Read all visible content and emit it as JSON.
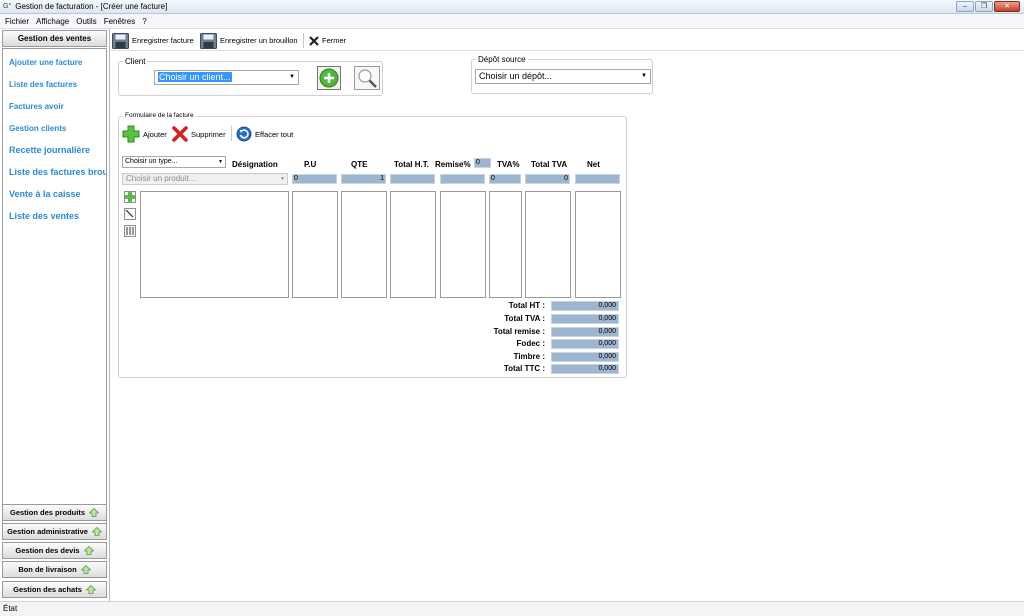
{
  "window": {
    "app_glyph": "G°",
    "title": "Gestion de facturation - [Créer une facture]"
  },
  "menu": [
    "Fichier",
    "Affichage",
    "Outils",
    "Fenêtres",
    "?"
  ],
  "sidebar": {
    "header": "Gestion des ventes",
    "links": [
      "Ajouter une facture",
      "Liste des factures",
      "Factures avoir",
      "Gestion clients",
      "Recette journalière",
      "Liste des factures brou",
      "Vente à la caisse",
      "Liste des ventes"
    ],
    "sections": [
      "Gestion des produits",
      "Gestion administrative",
      "Gestion des devis",
      "Bon de livraison",
      "Gestion des achats"
    ]
  },
  "toolbar": {
    "save_invoice": "Enregistrer facture",
    "save_draft": "Enregistrer un brouillon",
    "close": "Fermer"
  },
  "client": {
    "legend": "Client",
    "selected": "Choisir un client..."
  },
  "depot": {
    "legend": "Dépôt source",
    "selected": "Choisir un dépôt..."
  },
  "form": {
    "legend": "Formulaire de la facture",
    "add": "Ajouter",
    "delete": "Supprimer",
    "clear": "Effacer tout",
    "type_combo": "Choisir un type...",
    "product_combo": "Choisir un produit...",
    "columns": {
      "designation": "Désignation",
      "pu": "P.U",
      "qte": "QTE",
      "total_ht": "Total H.T.",
      "remise": "Remise%",
      "tva": "TVA%",
      "total_tva": "Total TVA",
      "net": "Net"
    },
    "values": {
      "remise_header": "0",
      "pu": "0",
      "qte": "1",
      "tva": "0",
      "total_tva": "0"
    }
  },
  "totals": [
    {
      "label": "Total HT    :",
      "value": "0,000"
    },
    {
      "label": "Total TVA :",
      "value": "0,000"
    },
    {
      "label": "Total remise :",
      "value": "0,000"
    },
    {
      "label": "Fodec :",
      "value": "0,000"
    },
    {
      "label": "Timbre :",
      "value": "0,000"
    },
    {
      "label": "Total TTC :",
      "value": "0,000"
    }
  ],
  "status": "État",
  "colors": {
    "link_blue": "#2c8ad6",
    "field_fill": "#9eb5cf",
    "selection": "#3399ff",
    "add_green": "#4fb83a",
    "delete_red": "#d3231c"
  }
}
